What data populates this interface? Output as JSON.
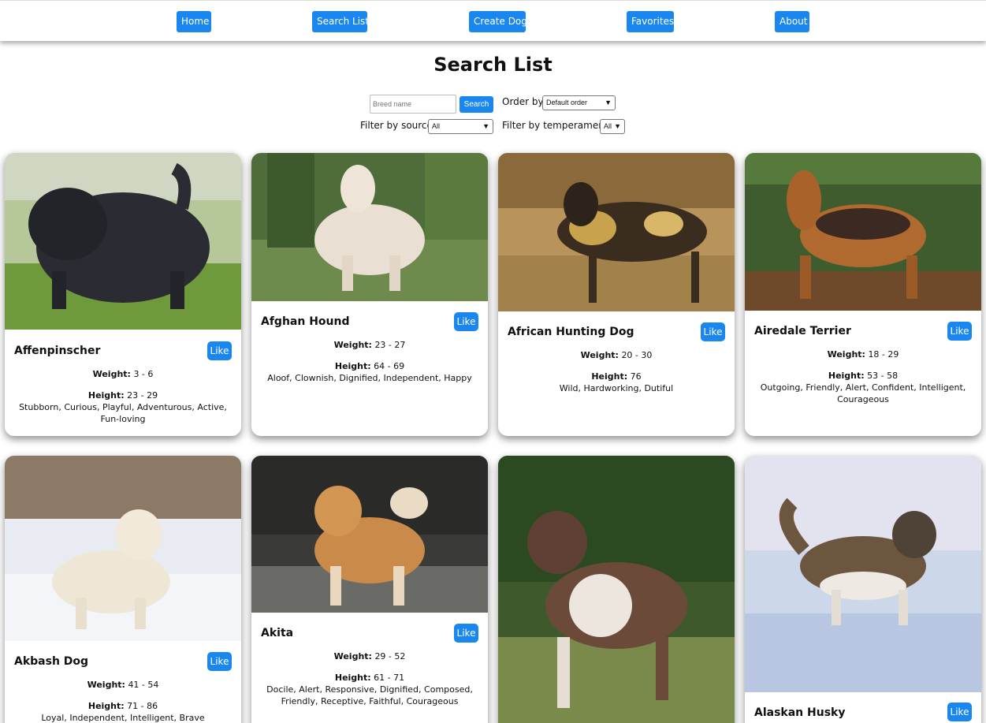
{
  "nav": {
    "items": [
      {
        "label": "Home",
        "name": "nav-home-button"
      },
      {
        "label": "Search List",
        "name": "nav-search-list-button"
      },
      {
        "label": "Create Dog",
        "name": "nav-create-dog-button"
      },
      {
        "label": "Favorites",
        "name": "nav-favorites-button"
      },
      {
        "label": "About",
        "name": "nav-about-button"
      }
    ]
  },
  "page": {
    "title": "Search List"
  },
  "search": {
    "placeholder": "Breed name",
    "button_label": "Search"
  },
  "order": {
    "label": "Order by:",
    "selected": "Default order"
  },
  "source_filter": {
    "label": "Filter by source:",
    "selected": "All"
  },
  "temperament_filter": {
    "label": "Filter by temperament:",
    "selected": "All"
  },
  "labels": {
    "weight": "Weight:",
    "height": "Height:",
    "like": "Like"
  },
  "dogs": [
    {
      "name": "Affenpinscher",
      "weight": "3 - 6",
      "height": "23 - 29",
      "temperament": "Stubborn, Curious, Playful, Adventurous, Active, Fun-loving"
    },
    {
      "name": "Afghan Hound",
      "weight": "23 - 27",
      "height": "64 - 69",
      "temperament": "Aloof, Clownish, Dignified, Independent, Happy"
    },
    {
      "name": "African Hunting Dog",
      "weight": "20 - 30",
      "height": "76",
      "temperament": "Wild, Hardworking, Dutiful"
    },
    {
      "name": "Airedale Terrier",
      "weight": "18 - 29",
      "height": "53 - 58",
      "temperament": "Outgoing, Friendly, Alert, Confident, Intelligent, Courageous"
    },
    {
      "name": "Akbash Dog",
      "weight": "41 - 54",
      "height": "71 - 86",
      "temperament": "Loyal, Independent, Intelligent, Brave"
    },
    {
      "name": "Akita",
      "weight": "29 - 52",
      "height": "61 - 71",
      "temperament": "Docile, Alert, Responsive, Dignified, Composed, Friendly, Receptive, Faithful, Courageous"
    },
    {
      "name": "",
      "weight": "",
      "height": "",
      "temperament": ""
    },
    {
      "name": "Alaskan Husky",
      "weight": "",
      "height": "",
      "temperament": ""
    }
  ]
}
